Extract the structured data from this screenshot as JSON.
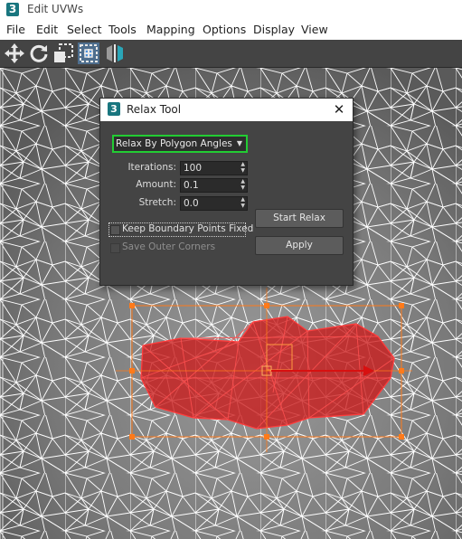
{
  "window": {
    "title": "Edit UVWs",
    "app_icon": "3ds-max-logo-icon"
  },
  "menu": [
    "File",
    "Edit",
    "Select",
    "Tools",
    "Mapping",
    "Options",
    "Display",
    "View"
  ],
  "toolbar": {
    "tools": [
      "move-icon",
      "rotate-icon",
      "scale-icon",
      "freeform-mode-icon",
      "mirror-icon"
    ]
  },
  "dialog": {
    "title": "Relax Tool",
    "close_glyph": "✕",
    "method": {
      "value": "Relax By Polygon Angles",
      "options_visible": [
        "Relax By Polygon Angles"
      ]
    },
    "params": [
      {
        "label": "Iterations:",
        "value": "100"
      },
      {
        "label": "Amount:",
        "value": "0.1"
      },
      {
        "label": "Stretch:",
        "value": "0.0"
      }
    ],
    "checkboxes": [
      {
        "label": "Keep Boundary Points Fixed",
        "checked": false,
        "enabled": true
      },
      {
        "label": "Save Outer Corners",
        "checked": false,
        "enabled": false
      }
    ],
    "start_button": "Start Relax",
    "apply_button": "Apply"
  },
  "colors": {
    "highlight_green": "#22cc33",
    "annotation_red": "#e52222",
    "selection_faces": "#cc1a1a",
    "gizmo_orange": "#ff7a1a",
    "mesh_wire": "#ffffff"
  }
}
